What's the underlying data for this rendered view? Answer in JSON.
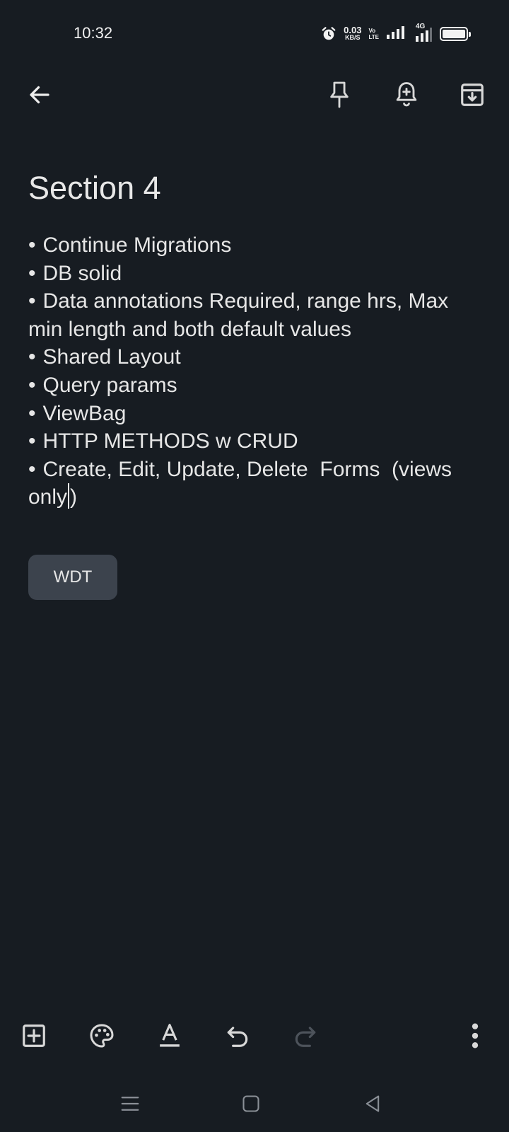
{
  "status_bar": {
    "time": "10:32",
    "net_speed_value": "0.03",
    "net_speed_unit": "KB/S",
    "volte_top": "Vo",
    "volte_bottom": "LTE",
    "network_type": "4G",
    "icons": [
      "alarm-icon",
      "volte-icon",
      "signal-icon",
      "signal-4g-icon",
      "battery-icon"
    ]
  },
  "top_bar": {
    "icons": [
      "back-arrow-icon",
      "pin-icon",
      "reminder-bell-icon",
      "archive-icon"
    ]
  },
  "note": {
    "title": "Section 4",
    "bullet_char": "•",
    "items": [
      "Continue Migrations",
      "DB solid",
      "Data annotations Required, range hrs, Max min length and both default values",
      "Shared Layout",
      "Query params",
      "ViewBag",
      "HTTP METHODS w CRUD",
      "Create, Edit, Update, Delete  Forms  (views only"
    ],
    "last_item_tail": ")"
  },
  "label": {
    "text": "WDT"
  },
  "bottom_toolbar": {
    "icons": [
      "add-box-icon",
      "palette-icon",
      "text-format-icon",
      "undo-icon",
      "redo-icon",
      "more-vert-icon"
    ]
  },
  "nav_bar": {
    "icons": [
      "recents-menu-icon",
      "home-square-icon",
      "back-triangle-icon"
    ]
  }
}
